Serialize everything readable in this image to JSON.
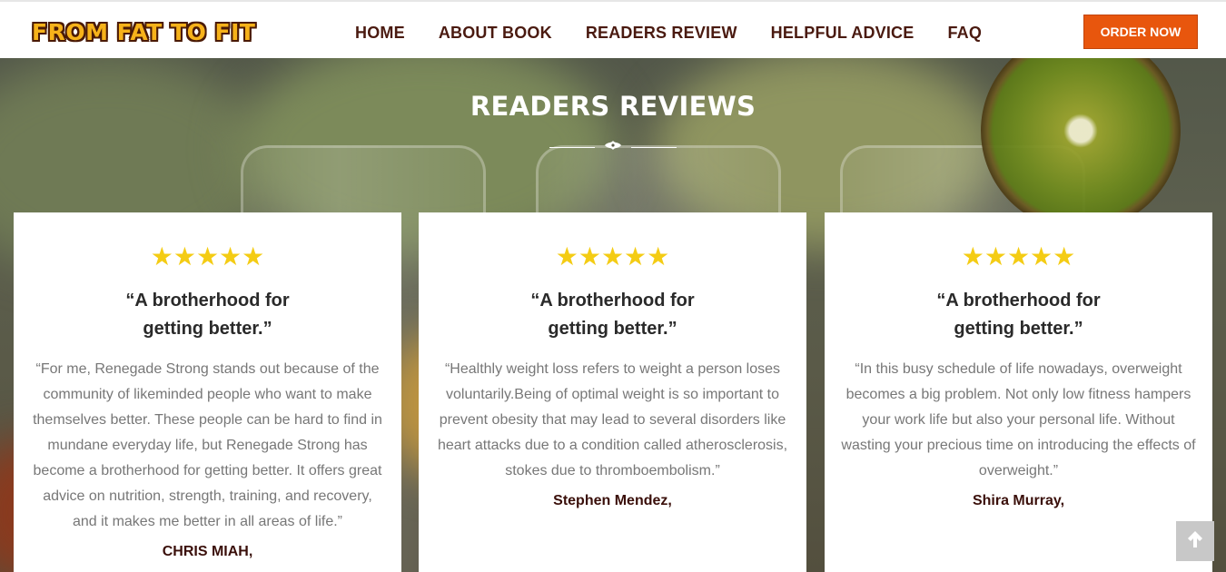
{
  "header": {
    "logo_text": "FROM FAT TO FIT",
    "nav": [
      {
        "label": "HOME"
      },
      {
        "label": "ABOUT BOOK"
      },
      {
        "label": "READERS REVIEW"
      },
      {
        "label": "HELPFUL ADVICE"
      },
      {
        "label": "FAQ"
      }
    ],
    "order_label": "ORDER NOW"
  },
  "section": {
    "title": "READERS REVIEWS",
    "divider_icon": "ornament-icon"
  },
  "reviews": [
    {
      "rating": 5,
      "stars": "★★★★★",
      "title": "“A brotherhood for getting better.”",
      "text": "“For me, Renegade Strong stands out because of the community of likeminded people who want to make themselves better. These people can be hard to find in mundane everyday life, but Renegade Strong has become a brotherhood for getting better. It offers great advice on nutrition, strength, training, and recovery, and it makes me better in all areas of life.”",
      "author": "CHRIS MIAH,"
    },
    {
      "rating": 5,
      "stars": "★★★★★",
      "title": "“A brotherhood for getting better.”",
      "text": "“Healthly weight loss refers to weight a person loses voluntarily.Being of optimal weight is so important to prevent obesity that may lead to several disorders like heart attacks due to a condition called atherosclerosis, stokes due to thromboembolism.”",
      "author": "Stephen Mendez,"
    },
    {
      "rating": 5,
      "stars": "★★★★★",
      "title": "“A brotherhood for getting better.”",
      "text": "“In this busy schedule of life nowadays, overweight becomes a big problem. Not only low fitness hampers your work life but also your personal life. Without wasting your precious time on introducing the effects of overweight.”",
      "author": "Shira Murray,"
    }
  ],
  "scroll_top_icon": "arrow-up-icon",
  "colors": {
    "accent": "#e8560d",
    "nav_text": "#4a1a10",
    "star": "#f4cc14",
    "logo_fill": "#f6b21a"
  }
}
